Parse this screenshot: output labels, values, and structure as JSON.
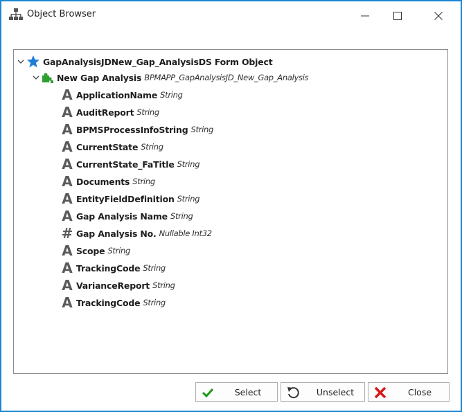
{
  "window": {
    "title": "Object Browser"
  },
  "tree": {
    "root": {
      "label": "GapAnalysisJDNew_Gap_AnalysisDS Form Object"
    },
    "child": {
      "label": "New Gap Analysis",
      "type": "BPMAPP_GapAnalysisJD_New_Gap_Analysis"
    },
    "properties": [
      {
        "name": "ApplicationName",
        "type": "String",
        "icon": "text-type-icon"
      },
      {
        "name": "AuditReport",
        "type": "String",
        "icon": "text-type-icon"
      },
      {
        "name": "BPMSProcessInfoString",
        "type": "String",
        "icon": "text-type-icon"
      },
      {
        "name": "CurrentState",
        "type": "String",
        "icon": "text-type-icon"
      },
      {
        "name": "CurrentState_FaTitle",
        "type": "String",
        "icon": "text-type-icon"
      },
      {
        "name": "Documents",
        "type": "String",
        "icon": "text-type-icon"
      },
      {
        "name": "EntityFieldDefinition",
        "type": "String",
        "icon": "text-type-icon"
      },
      {
        "name": "Gap Analysis Name",
        "type": "String",
        "icon": "text-type-icon"
      },
      {
        "name": "Gap Analysis No.",
        "type": "Nullable Int32",
        "icon": "number-type-icon"
      },
      {
        "name": "Scope",
        "type": "String",
        "icon": "text-type-icon"
      },
      {
        "name": "TrackingCode",
        "type": "String",
        "icon": "text-type-icon"
      },
      {
        "name": "VarianceReport",
        "type": "String",
        "icon": "text-type-icon"
      },
      {
        "name": "TrackingCode",
        "type": "String",
        "icon": "text-type-icon"
      }
    ]
  },
  "buttons": {
    "select": "Select",
    "unselect": "Unselect",
    "close": "Close"
  },
  "colors": {
    "border": "#1b86d3",
    "star": "#1e7fd8",
    "puzzle": "#2fa02f",
    "check": "#1a9a1a",
    "x": "#d81818"
  }
}
